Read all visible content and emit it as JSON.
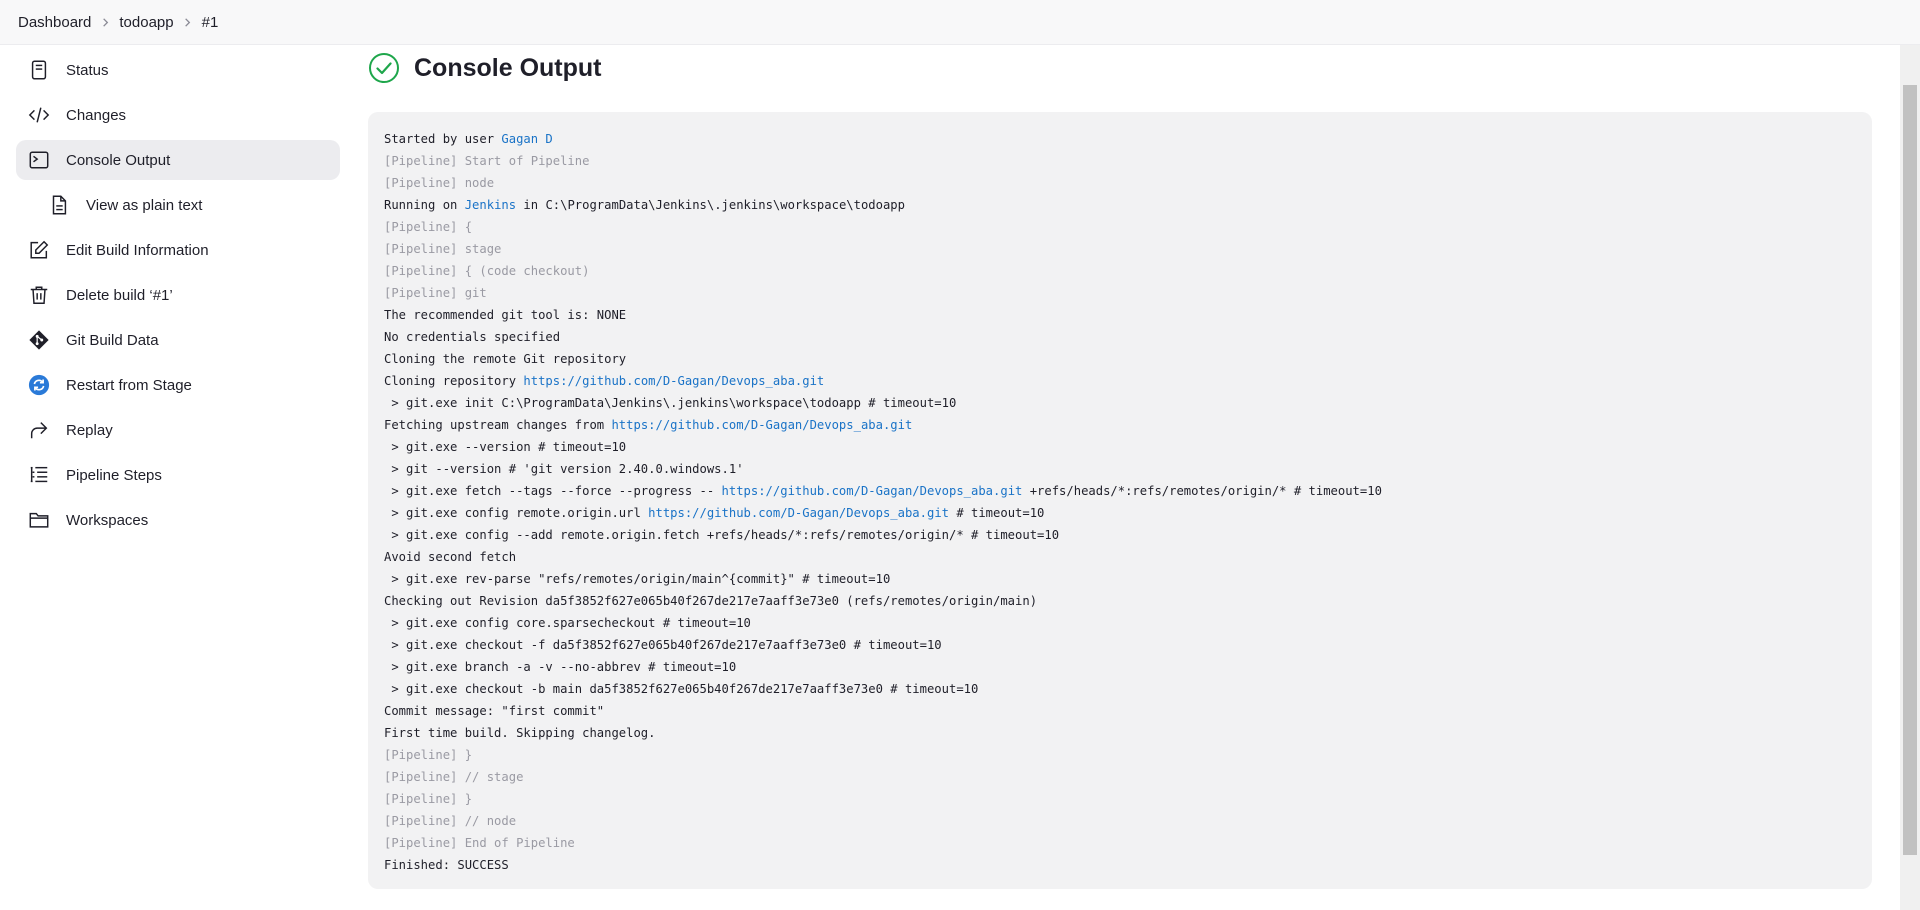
{
  "breadcrumb": [
    {
      "label": "Dashboard"
    },
    {
      "label": "todoapp"
    },
    {
      "label": "#1"
    }
  ],
  "sidebar": {
    "items": [
      {
        "label": "Status",
        "icon": "document-icon"
      },
      {
        "label": "Changes",
        "icon": "code-icon"
      },
      {
        "label": "Console Output",
        "icon": "terminal-icon",
        "active": true
      },
      {
        "label": "View as plain text",
        "icon": "file-icon",
        "sub": true
      },
      {
        "label": "Edit Build Information",
        "icon": "edit-icon"
      },
      {
        "label": "Delete build ‘#1’",
        "icon": "trash-icon"
      },
      {
        "label": "Git Build Data",
        "icon": "git-icon"
      },
      {
        "label": "Restart from Stage",
        "icon": "restart-icon"
      },
      {
        "label": "Replay",
        "icon": "replay-icon"
      },
      {
        "label": "Pipeline Steps",
        "icon": "list-icon"
      },
      {
        "label": "Workspaces",
        "icon": "folder-icon"
      }
    ]
  },
  "main": {
    "title": "Console Output",
    "status_color": "#1ea64b",
    "link_color": "#1a73c7"
  },
  "console": {
    "lines": [
      {
        "kind": "plain",
        "parts": [
          "Started by user ",
          {
            "link": "Gagan D"
          }
        ]
      },
      {
        "kind": "meta",
        "parts": [
          "[Pipeline] Start of Pipeline"
        ]
      },
      {
        "kind": "meta",
        "parts": [
          "[Pipeline] node"
        ]
      },
      {
        "kind": "plain",
        "parts": [
          "Running on ",
          {
            "link": "Jenkins"
          },
          " in C:\\ProgramData\\Jenkins\\.jenkins\\workspace\\todoapp"
        ]
      },
      {
        "kind": "meta",
        "parts": [
          "[Pipeline] {"
        ]
      },
      {
        "kind": "meta",
        "parts": [
          "[Pipeline] stage"
        ]
      },
      {
        "kind": "meta",
        "parts": [
          "[Pipeline] { (code checkout)"
        ]
      },
      {
        "kind": "meta",
        "parts": [
          "[Pipeline] git"
        ]
      },
      {
        "kind": "plain",
        "parts": [
          "The recommended git tool is: NONE"
        ]
      },
      {
        "kind": "plain",
        "parts": [
          "No credentials specified"
        ]
      },
      {
        "kind": "plain",
        "parts": [
          "Cloning the remote Git repository"
        ]
      },
      {
        "kind": "plain",
        "parts": [
          "Cloning repository ",
          {
            "link": "https://github.com/D-Gagan/Devops_aba.git"
          }
        ]
      },
      {
        "kind": "plain",
        "parts": [
          " > git.exe init C:\\ProgramData\\Jenkins\\.jenkins\\workspace\\todoapp # timeout=10"
        ]
      },
      {
        "kind": "plain",
        "parts": [
          "Fetching upstream changes from ",
          {
            "link": "https://github.com/D-Gagan/Devops_aba.git"
          }
        ]
      },
      {
        "kind": "plain",
        "parts": [
          " > git.exe --version # timeout=10"
        ]
      },
      {
        "kind": "plain",
        "parts": [
          " > git --version # 'git version 2.40.0.windows.1'"
        ]
      },
      {
        "kind": "plain",
        "parts": [
          " > git.exe fetch --tags --force --progress -- ",
          {
            "link": "https://github.com/D-Gagan/Devops_aba.git"
          },
          " +refs/heads/*:refs/remotes/origin/* # timeout=10"
        ]
      },
      {
        "kind": "plain",
        "parts": [
          " > git.exe config remote.origin.url ",
          {
            "link": "https://github.com/D-Gagan/Devops_aba.git"
          },
          " # timeout=10"
        ]
      },
      {
        "kind": "plain",
        "parts": [
          " > git.exe config --add remote.origin.fetch +refs/heads/*:refs/remotes/origin/* # timeout=10"
        ]
      },
      {
        "kind": "plain",
        "parts": [
          "Avoid second fetch"
        ]
      },
      {
        "kind": "plain",
        "parts": [
          " > git.exe rev-parse \"refs/remotes/origin/main^{commit}\" # timeout=10"
        ]
      },
      {
        "kind": "plain",
        "parts": [
          "Checking out Revision da5f3852f627e065b40f267de217e7aaff3e73e0 (refs/remotes/origin/main)"
        ]
      },
      {
        "kind": "plain",
        "parts": [
          " > git.exe config core.sparsecheckout # timeout=10"
        ]
      },
      {
        "kind": "plain",
        "parts": [
          " > git.exe checkout -f da5f3852f627e065b40f267de217e7aaff3e73e0 # timeout=10"
        ]
      },
      {
        "kind": "plain",
        "parts": [
          " > git.exe branch -a -v --no-abbrev # timeout=10"
        ]
      },
      {
        "kind": "plain",
        "parts": [
          " > git.exe checkout -b main da5f3852f627e065b40f267de217e7aaff3e73e0 # timeout=10"
        ]
      },
      {
        "kind": "plain",
        "parts": [
          "Commit message: \"first commit\""
        ]
      },
      {
        "kind": "plain",
        "parts": [
          "First time build. Skipping changelog."
        ]
      },
      {
        "kind": "meta",
        "parts": [
          "[Pipeline] }"
        ]
      },
      {
        "kind": "meta",
        "parts": [
          "[Pipeline] // stage"
        ]
      },
      {
        "kind": "meta",
        "parts": [
          "[Pipeline] }"
        ]
      },
      {
        "kind": "meta",
        "parts": [
          "[Pipeline] // node"
        ]
      },
      {
        "kind": "meta",
        "parts": [
          "[Pipeline] End of Pipeline"
        ]
      },
      {
        "kind": "plain",
        "parts": [
          "Finished: SUCCESS"
        ]
      }
    ]
  }
}
